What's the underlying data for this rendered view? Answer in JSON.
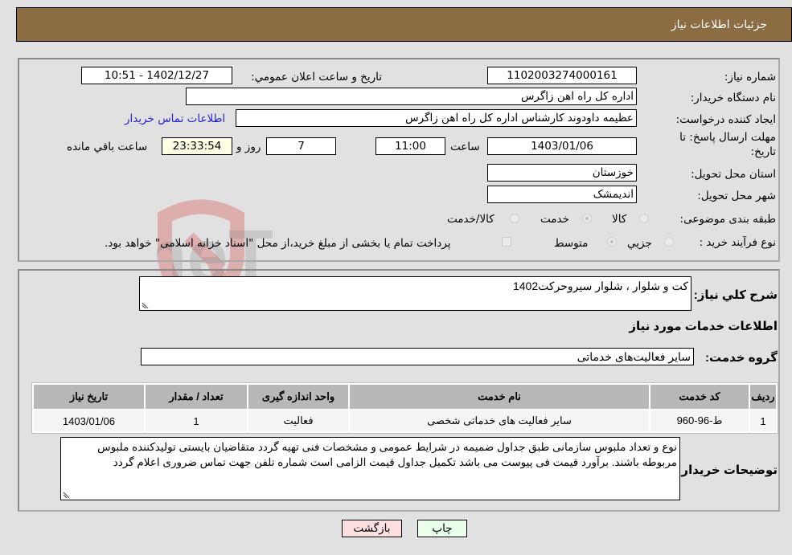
{
  "header": {
    "title": "جزئیات اطلاعات نیاز"
  },
  "form": {
    "need_number_label": "شماره نیاز:",
    "need_number": "1102003274000161",
    "announce_label": "تاريخ و ساعت اعلان عمومي:",
    "announce_value": "1402/12/27 - 10:51",
    "buyer_org_label": "نام دستگاه خریدار:",
    "buyer_org": "اداره کل راه اهن زاگرس",
    "creator_label": "ایجاد کننده درخواست:",
    "creator": "عظیمه  داودوند کارشناس اداره کل راه اهن زاگرس",
    "contact_link": "اطلاعات تماس خریدار",
    "deadline_label_1": "مهلت ارسال پاسخ: تا",
    "deadline_label_2": "تاریخ:",
    "deadline_date": "1403/01/06",
    "time_label": "ساعت",
    "deadline_time": "11:00",
    "days_value": "7",
    "days_label": "روز و",
    "remaining_time": "23:33:54",
    "remaining_label": "ساعت باقي مانده",
    "province_label": "استان محل تحویل:",
    "province": "خوزستان",
    "city_label": "شهر محل تحویل:",
    "city": "اندیمشک",
    "category_label": "طبقه بندی موضوعی:",
    "category_options": [
      {
        "label": "کالا",
        "selected": false
      },
      {
        "label": "خدمت",
        "selected": true
      },
      {
        "label": "کالا/خدمت",
        "selected": false
      }
    ],
    "purchase_type_label": "نوع فرآیند خرید :",
    "purchase_type_options": [
      {
        "label": "جزيي",
        "selected": false
      },
      {
        "label": "متوسط",
        "selected": true
      }
    ],
    "treasury_note": "پرداخت تمام یا بخشی از مبلغ خرید،از محل \"اسناد خزانه اسلامی\" خواهد بود."
  },
  "description": {
    "label": "شرح کلي نياز:",
    "value": "کت و شلوار ، شلوار سیروحرکت1402"
  },
  "services": {
    "section_title": "اطلاعات خدمات مورد نياز",
    "group_label": "گروه خدمت:",
    "group_value": "سایر فعالیت‌های خدماتی",
    "table": {
      "headers": [
        "رديف",
        "کد خدمت",
        "نام خدمت",
        "واحد اندازه گیری",
        "تعداد / مقدار",
        "تاریخ نیاز"
      ],
      "rows": [
        [
          "1",
          "ط-96-960",
          "سایر فعالیت های خدماتی شخصی",
          "فعالیت",
          "1",
          "1403/01/06"
        ]
      ]
    }
  },
  "buyer_notes": {
    "label": "توضیحات خریدار:",
    "value": "نوع و تعداد ملبوس سازمانی طبق جداول ضمیمه در شرایط عمومی و مشخصات فنی تهیه گردد متقاضیان بایستی تولیدکننده ملبوس مربوطه باشند. برآورد قیمت فی پیوست می باشد تکمیل جداول قیمت الزامی است شماره تلفن جهت تماس ضروری اعلام گردد"
  },
  "buttons": {
    "print": "چاپ",
    "back": "بازگشت"
  },
  "colors": {
    "header_bg": "#8c6c42",
    "print_bg": "#eaffea",
    "back_bg": "#ffe0e0",
    "remaining_bg": "#ffffe6",
    "link": "#2222cc"
  }
}
